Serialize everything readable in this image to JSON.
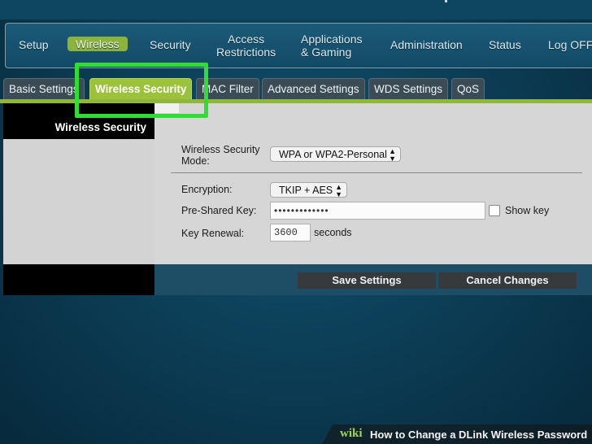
{
  "main_nav": {
    "items": [
      {
        "id": "setup",
        "label": "Setup"
      },
      {
        "id": "wireless",
        "label": "Wireless"
      },
      {
        "id": "security",
        "label": "Security"
      },
      {
        "id": "access",
        "label": "Access\nRestrictions"
      },
      {
        "id": "apps",
        "label": "Applications\n& Gaming"
      },
      {
        "id": "admin",
        "label": "Administration"
      },
      {
        "id": "status",
        "label": "Status"
      },
      {
        "id": "logoff",
        "label": "Log OFF"
      }
    ],
    "active": "wireless"
  },
  "sub_tabs": [
    {
      "label": "Basic Settings"
    },
    {
      "label": "Wireless Security"
    },
    {
      "label": "MAC Filter"
    },
    {
      "label": "Advanced Settings"
    },
    {
      "label": "WDS Settings"
    },
    {
      "label": "QoS"
    }
  ],
  "sidebar": {
    "section_title": "Wireless Security"
  },
  "form": {
    "security_mode_label": "Wireless Security\nMode:",
    "security_mode_value": "WPA or WPA2-Personal",
    "encryption_label": "Encryption:",
    "encryption_value": "TKIP + AES",
    "psk_label": "Pre-Shared Key:",
    "psk_value": "•••••••••••••",
    "show_key_label": "Show key",
    "show_key_checked": false,
    "renewal_label": "Key Renewal:",
    "renewal_value": "3600",
    "renewal_unit": "seconds"
  },
  "buttons": {
    "save": "Save Settings",
    "cancel": "Cancel Changes"
  },
  "watermark": {
    "brand": "wiki",
    "title": "How to Change a DLink Wireless Password"
  },
  "colors": {
    "accent_green": "#8cb33a",
    "highlight_green": "#2ede33",
    "panel_gray": "#d6d6d6"
  }
}
